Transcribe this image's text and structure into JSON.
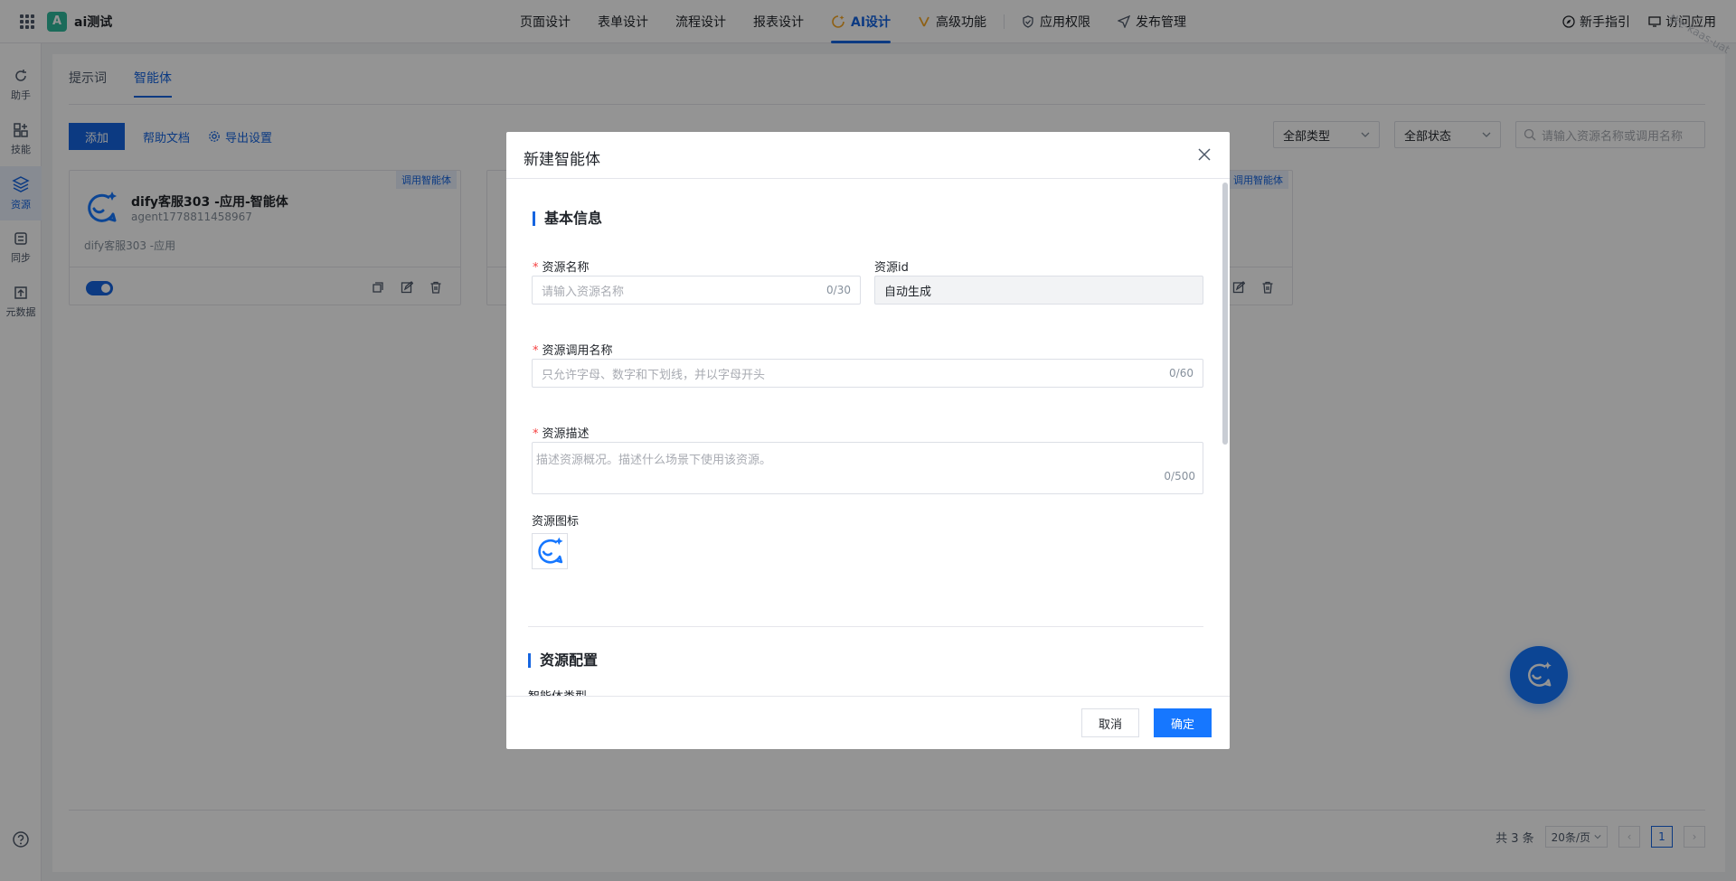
{
  "app": {
    "badge": "A",
    "name": "ai测试"
  },
  "nav": [
    {
      "label": "页面设计"
    },
    {
      "label": "表单设计"
    },
    {
      "label": "流程设计"
    },
    {
      "label": "报表设计"
    },
    {
      "label": "AI设计"
    },
    {
      "label": "高级功能"
    },
    {
      "label": "应用权限"
    },
    {
      "label": "发布管理"
    }
  ],
  "header_right": {
    "guide": "新手指引",
    "visit": "访问应用"
  },
  "watermark": "tke-kaas-uat",
  "sidenav": [
    {
      "label": "助手"
    },
    {
      "label": "技能"
    },
    {
      "label": "资源"
    },
    {
      "label": "同步"
    },
    {
      "label": "元数据"
    }
  ],
  "tabs": [
    {
      "label": "提示词"
    },
    {
      "label": "智能体"
    }
  ],
  "toolbar": {
    "add": "添加",
    "help": "帮助文档",
    "export": "导出设置"
  },
  "filters": {
    "type": "全部类型",
    "status": "全部状态",
    "search_placeholder": "请输入资源名称或调用名称"
  },
  "cards": [
    {
      "tag": "调用智能体",
      "title": "dify客服303 -应用-智能体",
      "sub": "agent1778811458967",
      "desc": "dify客服303 -应用"
    },
    {
      "tag": "调用智能体"
    }
  ],
  "pager": {
    "total": "共 3 条",
    "size": "20条/页",
    "page": "1"
  },
  "modal": {
    "title": "新建智能体",
    "section_basic": "基本信息",
    "name_label": "资源名称",
    "name_placeholder": "请输入资源名称",
    "name_counter": "0/30",
    "id_label": "资源id",
    "id_value": "自动生成",
    "call_label": "资源调用名称",
    "call_placeholder": "只允许字母、数字和下划线，并以字母开头",
    "call_counter": "0/60",
    "desc_label": "资源描述",
    "desc_placeholder": "描述资源概况。描述什么场景下使用该资源。",
    "desc_counter": "0/500",
    "icon_label": "资源图标",
    "section_config": "资源配置",
    "cutoff_label": "智能体类型",
    "cancel": "取消",
    "confirm": "确定"
  },
  "colors": {
    "primary": "#1665e0",
    "fab": "#1677ff",
    "required": "#f53f3f"
  }
}
